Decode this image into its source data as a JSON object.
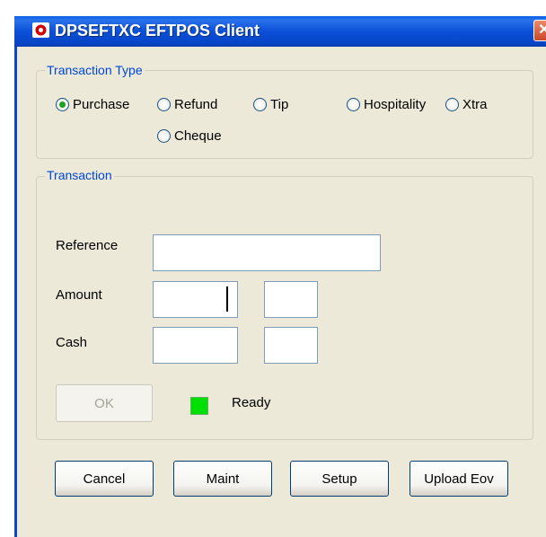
{
  "window": {
    "title": "DPSEFTXC EFTPOS Client",
    "close_glyph": "✕",
    "icon": "app-icon"
  },
  "transaction_type": {
    "legend": "Transaction Type",
    "options": [
      {
        "label": "Purchase",
        "checked": true
      },
      {
        "label": "Refund",
        "checked": false
      },
      {
        "label": "Tip",
        "checked": false
      },
      {
        "label": "Hospitality",
        "checked": false
      },
      {
        "label": "Xtra",
        "checked": false
      },
      {
        "label": "Cheque",
        "checked": false
      }
    ]
  },
  "transaction": {
    "legend": "Transaction",
    "reference_label": "Reference",
    "reference_value": "",
    "amount_label": "Amount",
    "amount_value": "",
    "amount_cents": "",
    "cash_label": "Cash",
    "cash_value": "",
    "cash_cents": "",
    "ok_label": "OK",
    "status_text": "Ready",
    "status_color": "#00e000"
  },
  "buttons": {
    "cancel": "Cancel",
    "maint": "Maint",
    "setup": "Setup",
    "upload": "Upload Eov"
  }
}
